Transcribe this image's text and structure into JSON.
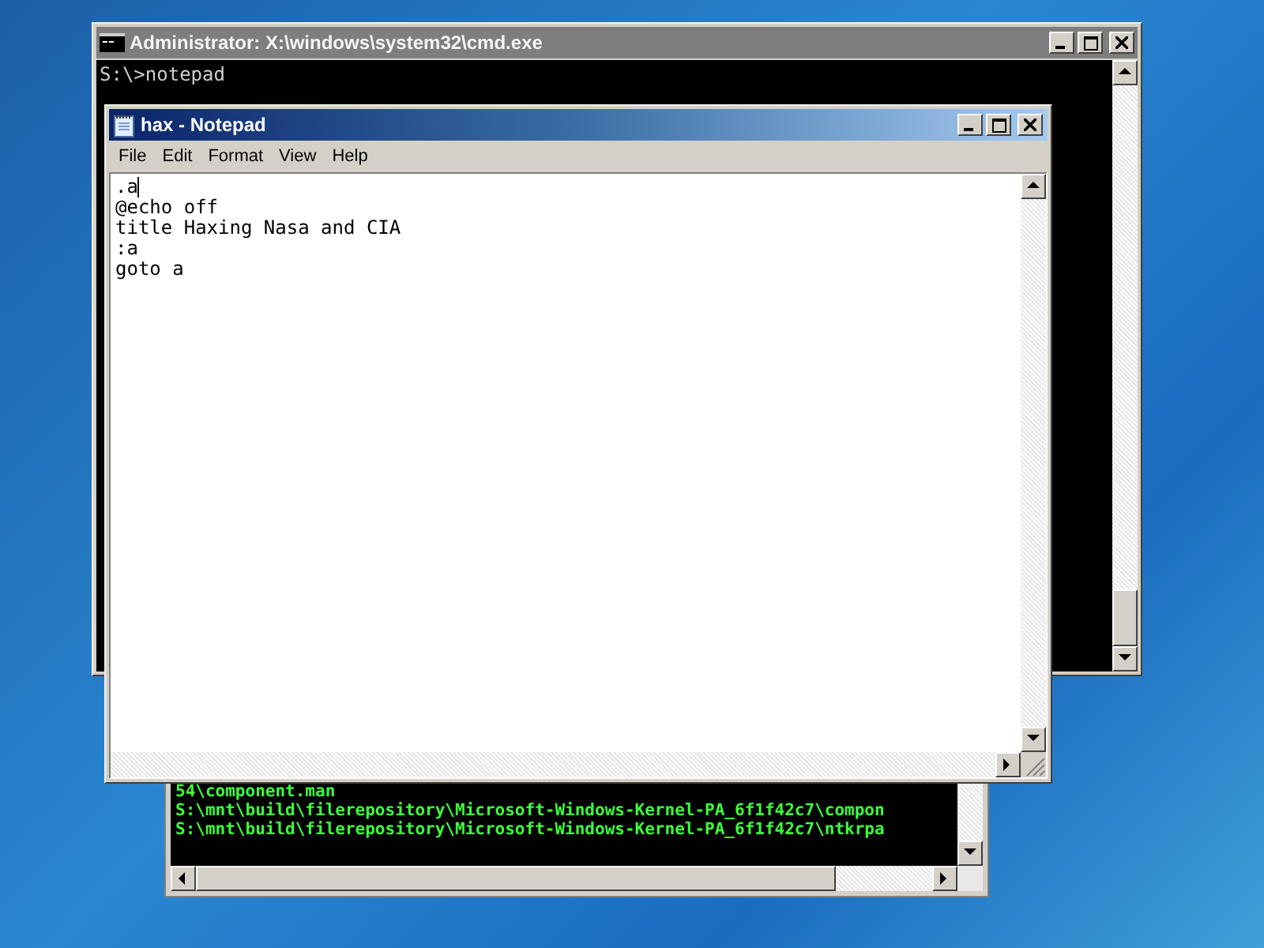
{
  "cmd_window": {
    "title": "Administrator: X:\\windows\\system32\\cmd.exe",
    "lines": [
      "S:\\>notepad"
    ]
  },
  "console_window": {
    "lines": [
      "54\\component.man",
      "S:\\mnt\\build\\filerepository\\Microsoft-Windows-Kernel-PA_6f1f42c7\\compon",
      "S:\\mnt\\build\\filerepository\\Microsoft-Windows-Kernel-PA_6f1f42c7\\ntkrpa"
    ]
  },
  "notepad": {
    "title": "hax - Notepad",
    "menu": [
      "File",
      "Edit",
      "Format",
      "View",
      "Help"
    ],
    "lines": [
      ".a",
      "@echo off",
      "title Haxing Nasa and CIA",
      ":a",
      "goto a"
    ]
  }
}
